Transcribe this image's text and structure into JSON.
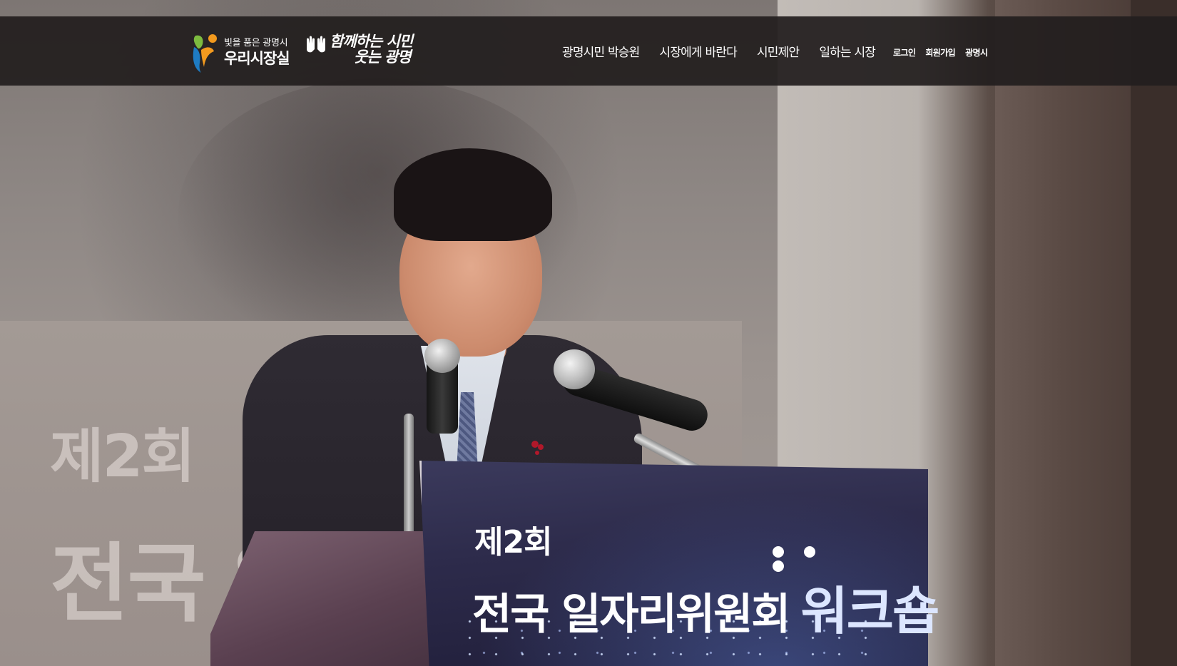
{
  "header": {
    "logo": {
      "subtitle": "빛을 품은 광명시",
      "title": "우리시장실"
    },
    "slogan": {
      "line1": "함께하는 시민",
      "line2": "웃는 광명"
    },
    "main_nav": [
      {
        "label": "광명시민 박승원"
      },
      {
        "label": "시장에게 바란다"
      },
      {
        "label": "시민제안"
      },
      {
        "label": "일하는 시장"
      }
    ],
    "util_nav": [
      {
        "label": "로그인"
      },
      {
        "label": "회원가입"
      },
      {
        "label": "광명시"
      }
    ]
  },
  "hero": {
    "screen_text_line1": "제2회",
    "screen_text_line2": "전국 일",
    "podium_text_line1": "제2회",
    "podium_text_line2": "전국 일자리위원회",
    "podium_text_accent": "워크숍"
  },
  "colors": {
    "header_bg": "#221e1e",
    "text": "#ffffff",
    "logo_green": "#7dbb3f",
    "logo_blue": "#1e7bc2",
    "logo_orange": "#f39a1e"
  }
}
